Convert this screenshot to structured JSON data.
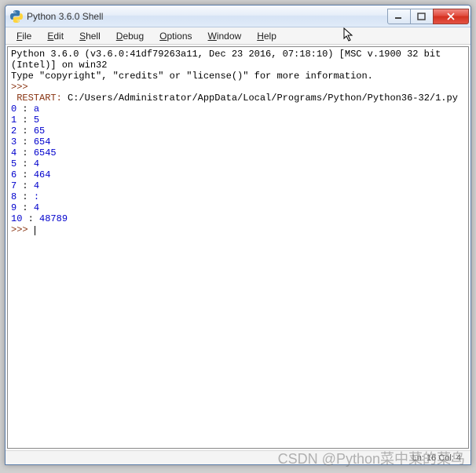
{
  "window": {
    "title": "Python 3.6.0 Shell"
  },
  "menu": {
    "items": [
      "File",
      "Edit",
      "Shell",
      "Debug",
      "Options",
      "Window",
      "Help"
    ]
  },
  "shell": {
    "header_part1": "Python 3.6.0 (v3.6.0:41df79263a11, Dec 23 2016, 07:18:10) [MSC v.1900 32 bit (Intel)] on win32",
    "header_part2": "Type \"copyright\", \"credits\" or \"license()\" for more information.",
    "prompt1": ">>>",
    "restart_label": " RESTART: ",
    "restart_path": "C:/Users/Administrator/AppData/Local/Programs/Python/Python36-32/1.py",
    "output_lines": [
      {
        "idx": "0",
        "val": "a"
      },
      {
        "idx": "1",
        "val": "5"
      },
      {
        "idx": "2",
        "val": "65"
      },
      {
        "idx": "3",
        "val": "654"
      },
      {
        "idx": "4",
        "val": "6545"
      },
      {
        "idx": "5",
        "val": "4"
      },
      {
        "idx": "6",
        "val": "464"
      },
      {
        "idx": "7",
        "val": "4"
      },
      {
        "idx": "8",
        "val": ":"
      },
      {
        "idx": "9",
        "val": "4"
      },
      {
        "idx": "10",
        "val": "48789"
      }
    ],
    "prompt2": ">>>"
  },
  "status": {
    "text": "Ln: 16  Col: 4"
  },
  "watermark": "CSDN @Python菜中菜的菜鸟"
}
